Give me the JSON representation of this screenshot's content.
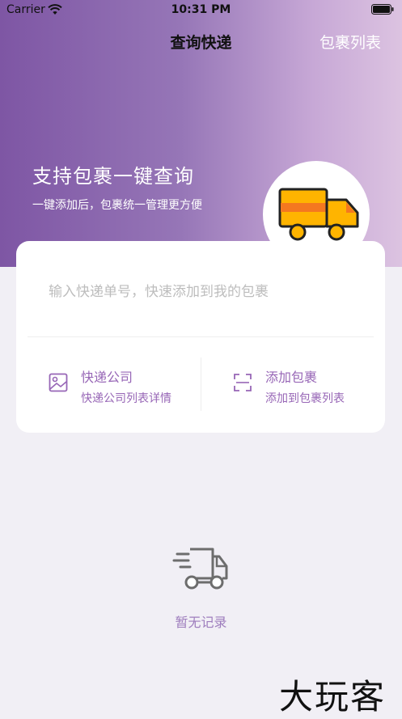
{
  "status_bar": {
    "carrier": "Carrier",
    "time": "10:31 PM"
  },
  "nav": {
    "title": "查询快递",
    "right_button": "包裹列表"
  },
  "hero": {
    "title": "支持包裹一键查询",
    "subtitle": "一键添加后，包裹统一管理更方便"
  },
  "search": {
    "placeholder": "输入快递单号，快速添加到我的包裹"
  },
  "actions": [
    {
      "title": "快递公司",
      "subtitle": "快递公司列表详情",
      "icon": "image-icon"
    },
    {
      "title": "添加包裹",
      "subtitle": "添加到包裹列表",
      "icon": "scan-icon"
    }
  ],
  "empty_state": {
    "text": "暂无记录",
    "icon": "delivery-truck-icon"
  },
  "watermark": "大玩客",
  "colors": {
    "accent": "#9766b6",
    "hero_start": "#7e56a4",
    "hero_end": "#dcc3e1",
    "background": "#f1eff5"
  }
}
